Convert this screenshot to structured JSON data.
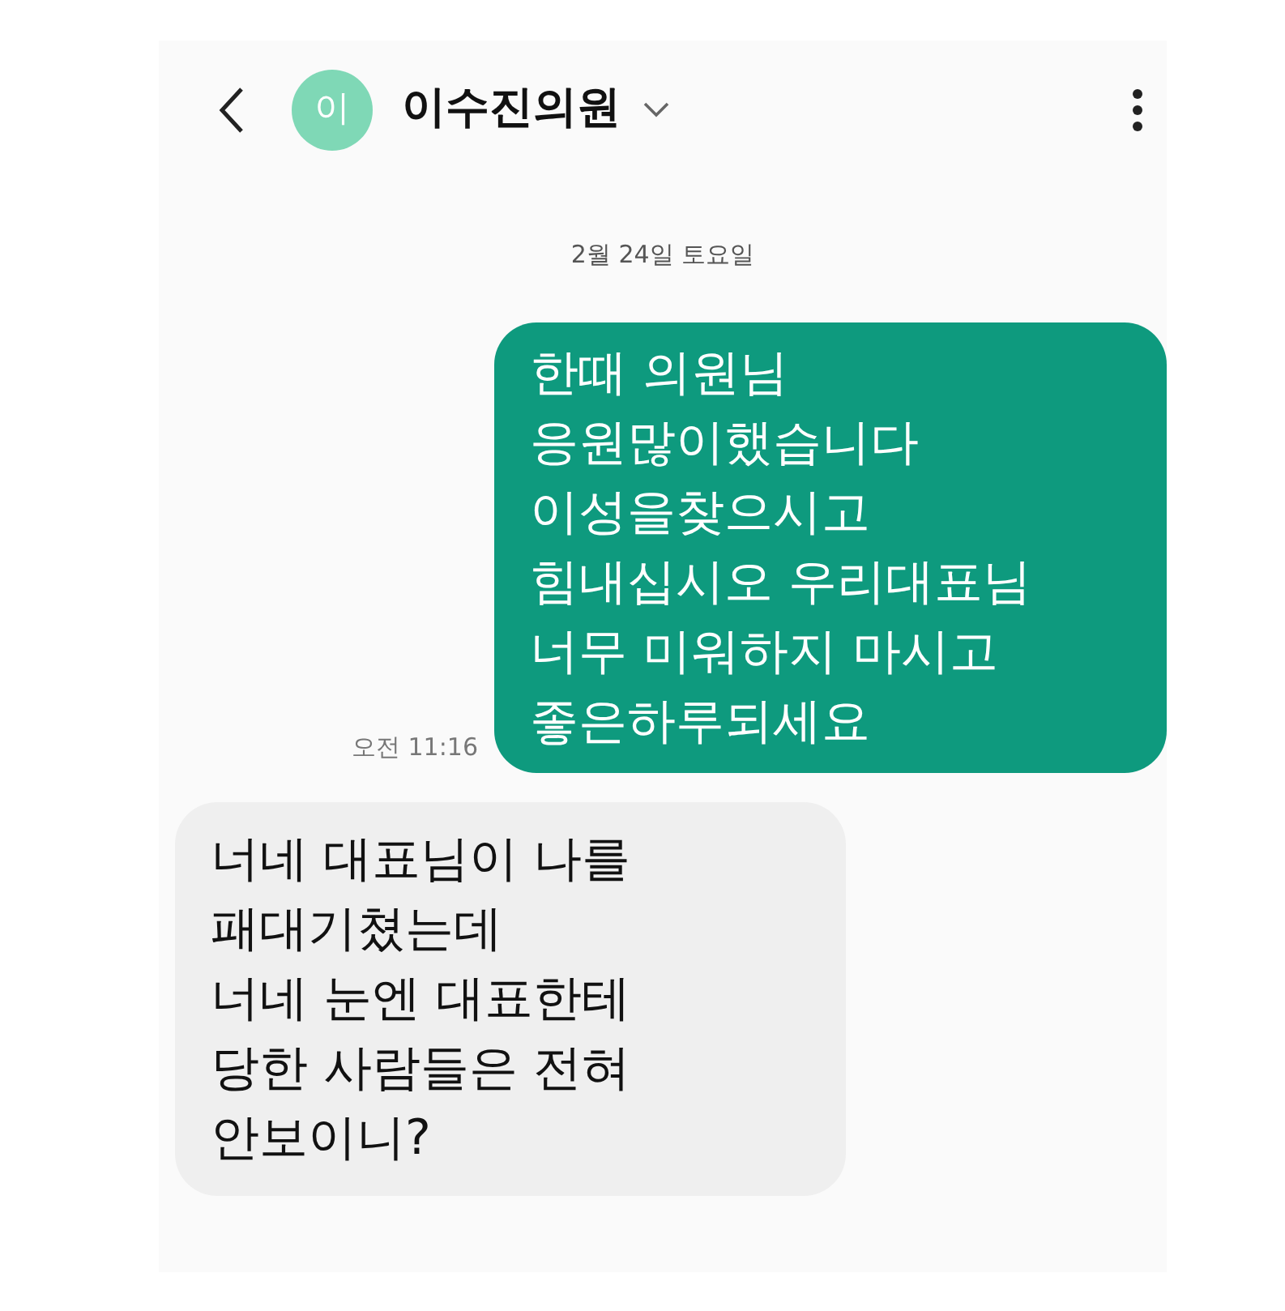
{
  "header": {
    "avatar_initial": "이",
    "contact_name": "이수진의원"
  },
  "date_divider": "2월 24일 토요일",
  "messages": [
    {
      "kind": "sent",
      "text": "한때 의원님\n응원많이했습니다\n이성을찾으시고\n힘내십시오 우리대표님\n너무 미워하지 마시고\n좋은하루되세요",
      "time": "오전 11:16"
    },
    {
      "kind": "received",
      "text": "너네 대표님이 나를\n패대기쳤는데\n너네 눈엔 대표한테\n당한 사람들은 전혀\n안보이니?"
    }
  ]
}
